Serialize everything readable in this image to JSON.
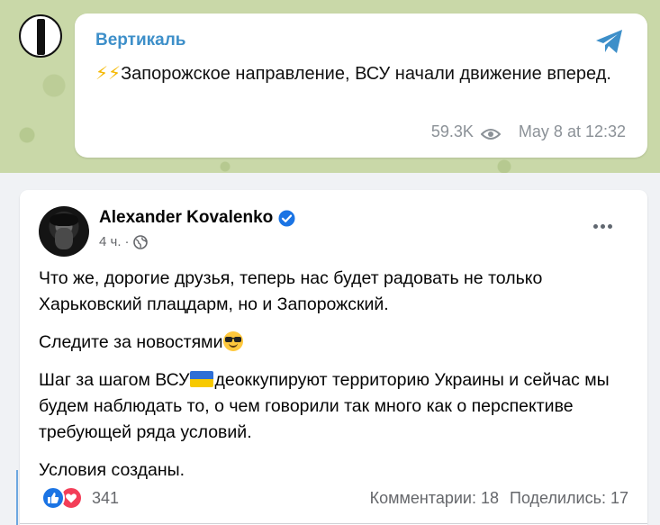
{
  "telegram": {
    "channel_name": "Вертикаль",
    "message_text": "Запорожское направление, ВСУ начали движение вперед.",
    "emoji": "⚡⚡",
    "views": "59.3K",
    "timestamp": "May 8 at 12:32",
    "share_icon": "paper-plane-icon",
    "views_icon": "eye-icon",
    "colors": {
      "accent": "#3d8fc9",
      "background": "#c9d8a8"
    }
  },
  "facebook": {
    "author_name": "Alexander Kovalenko",
    "verified_icon": "verified-badge-icon",
    "time_ago": "4 ч.",
    "separator": "·",
    "audience_icon": "globe-icon",
    "more_icon": "more-dots-icon",
    "paragraphs": {
      "p1": "Что же, дорогие друзья, теперь нас будет радовать не только Харьковский плацдарм, но и Запорожский.",
      "p2": "Следите за новостями",
      "p3_before": "Шаг за шагом ВСУ",
      "p3_after": "деоккупируют территорию Украины и сейчас мы будем наблюдать то, о чем говорили так много как о перспективе требующей ряда условий.",
      "p4": "Условия созданы."
    },
    "reactions_count": "341",
    "comments": "Комментарии: 18",
    "shares": "Поделились: 17",
    "colors": {
      "like": "#1b74e4",
      "love": "#f33e58",
      "text_muted": "#65676b"
    }
  }
}
